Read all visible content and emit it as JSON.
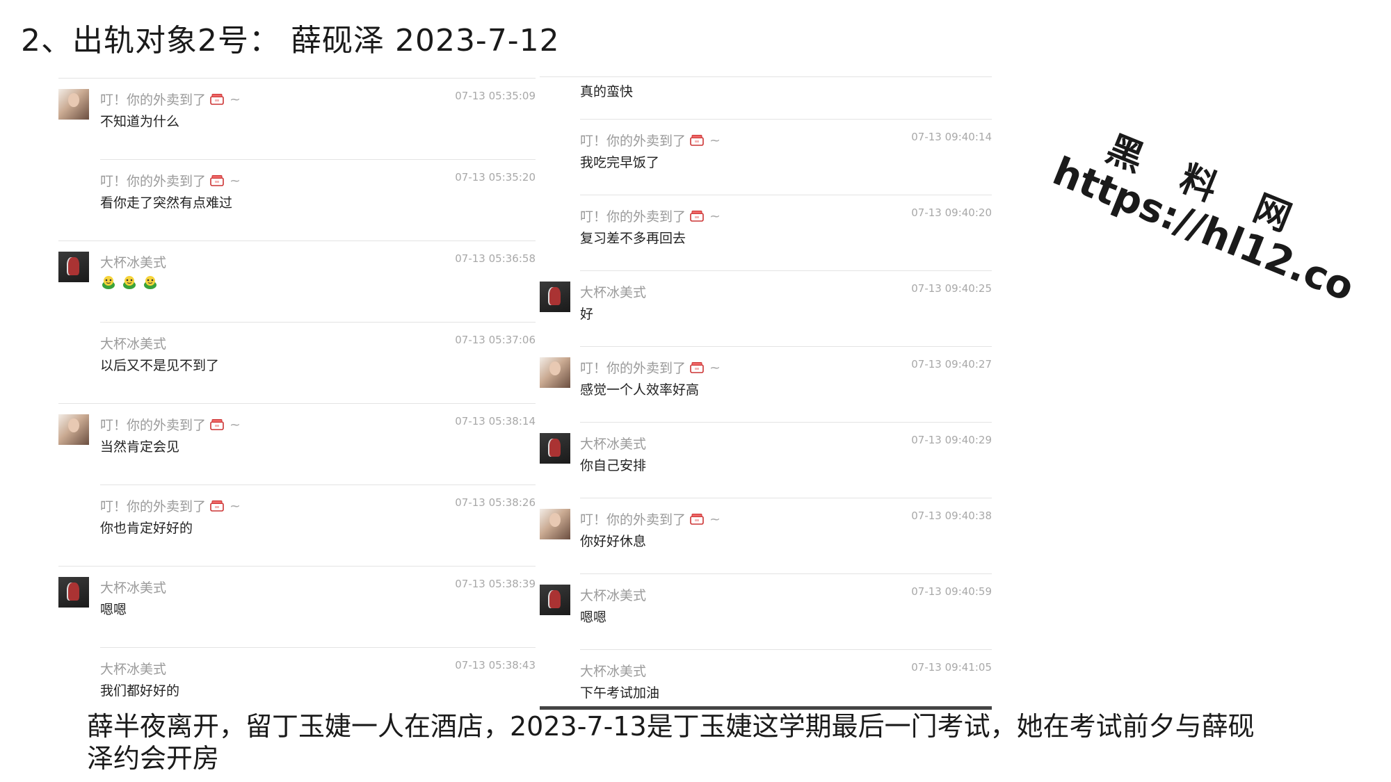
{
  "page_title": "2、出轨对象2号：  薛砚泽  2023-7-12",
  "watermark": {
    "line1": "黑 料 网",
    "line2": "https://hl12.co"
  },
  "left_panel": {
    "messages": [
      {
        "sender": "叮！你的外卖到了",
        "sender_icon": "box-icon",
        "tilde": "~",
        "time": "07-13 05:35:09",
        "text": "不知道为什么",
        "avatar": "girl-avatar"
      },
      {
        "sender": "叮！你的外卖到了",
        "sender_icon": "box-icon",
        "tilde": "~",
        "time": "07-13 05:35:20",
        "text": "看你走了突然有点难过",
        "avatar": ""
      },
      {
        "sender": "大杯冰美式",
        "time": "07-13 05:36:58",
        "text": "",
        "emoji": [
          "frog-emoji",
          "frog-emoji",
          "frog-emoji"
        ],
        "avatar": "boy-avatar"
      },
      {
        "sender": "大杯冰美式",
        "time": "07-13 05:37:06",
        "text": "以后又不是见不到了",
        "avatar": ""
      },
      {
        "sender": "叮！你的外卖到了",
        "sender_icon": "box-icon",
        "tilde": "~",
        "time": "07-13 05:38:14",
        "text": "当然肯定会见",
        "avatar": "girl-avatar"
      },
      {
        "sender": "叮！你的外卖到了",
        "sender_icon": "box-icon",
        "tilde": "~",
        "time": "07-13 05:38:26",
        "text": "你也肯定好好的",
        "avatar": ""
      },
      {
        "sender": "大杯冰美式",
        "time": "07-13 05:38:39",
        "text": "嗯嗯",
        "avatar": "boy-avatar"
      },
      {
        "sender": "大杯冰美式",
        "time": "07-13 05:38:43",
        "text": "我们都好好的",
        "avatar": ""
      }
    ]
  },
  "right_panel": {
    "top_partial_text": "真的蛮快",
    "messages": [
      {
        "sender": "叮！你的外卖到了",
        "sender_icon": "box-icon",
        "tilde": "~",
        "time": "07-13 09:40:14",
        "text": "我吃完早饭了",
        "avatar": ""
      },
      {
        "sender": "叮！你的外卖到了",
        "sender_icon": "box-icon",
        "tilde": "~",
        "time": "07-13 09:40:20",
        "text": "复习差不多再回去",
        "avatar": ""
      },
      {
        "sender": "大杯冰美式",
        "time": "07-13 09:40:25",
        "text": "好",
        "avatar": "boy-avatar"
      },
      {
        "sender": "叮！你的外卖到了",
        "sender_icon": "box-icon",
        "tilde": "~",
        "time": "07-13 09:40:27",
        "text": "感觉一个人效率好高",
        "avatar": "girl-avatar"
      },
      {
        "sender": "大杯冰美式",
        "time": "07-13 09:40:29",
        "text": "你自己安排",
        "avatar": "boy-avatar"
      },
      {
        "sender": "叮！你的外卖到了",
        "sender_icon": "box-icon",
        "tilde": "~",
        "time": "07-13 09:40:38",
        "text": "你好好休息",
        "avatar": "girl-avatar"
      },
      {
        "sender": "大杯冰美式",
        "time": "07-13 09:40:59",
        "text": "嗯嗯",
        "avatar": "boy-avatar"
      },
      {
        "sender": "大杯冰美式",
        "time": "07-13 09:41:05",
        "text": "下午考试加油",
        "avatar": ""
      }
    ]
  },
  "caption": "薛半夜离开，留丁玉婕一人在酒店，2023-7-13是丁玉婕这学期最后一门考试，她在考试前夕与薛砚泽约会开房"
}
